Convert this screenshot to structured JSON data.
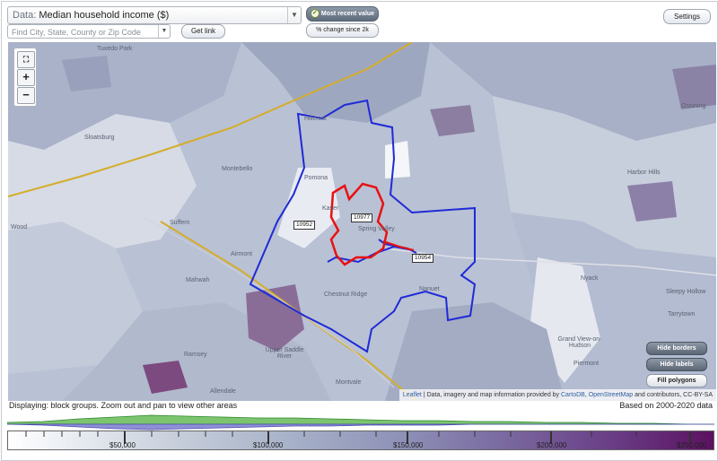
{
  "controls": {
    "data_prefix": "Data:",
    "data_value": "Median household income ($)",
    "search_placeholder": "Find City, State, County or Zip Code",
    "get_link": "Get link",
    "most_recent": "Most recent value",
    "pct_change": "% change since 2k",
    "settings": "Settings"
  },
  "map": {
    "towns": [
      "Tuxedo Park",
      "Sloatsburg",
      "Montebello",
      "Suffern",
      "Airmont",
      "Mahwah",
      "Ramsey",
      "Upper Saddle River",
      "Allendale",
      "Montvale",
      "Pomona",
      "Kaser",
      "Spring Valley",
      "Chestnut Ridge",
      "Nanuet",
      "Nyack",
      "Grand View-on-Hudson",
      "Piermont",
      "Sleepy Hollow",
      "Tarrytown",
      "Ossining",
      "Harbor Hills",
      "Hillcrest",
      "Wood"
    ],
    "zip_labels": [
      "10952",
      "10977",
      "10954"
    ],
    "buttons": {
      "hide_borders": "Hide borders",
      "hide_labels": "Hide labels",
      "fill_polygons": "Fill polygons"
    },
    "attribution": {
      "leaflet": "Leaflet",
      "text": " | Data, imagery and map information provided by ",
      "cartodb": "CartoDB",
      "comma": ", ",
      "osm": "OpenStreetMap",
      "tail": " and contributors, CC-BY-SA"
    },
    "colors": {
      "border_blue": "#1f2bd6",
      "border_red": "#e81111",
      "road": "#d4ad2a"
    }
  },
  "footer": {
    "displaying": "Displaying: block groups. Zoom out and pan to view other areas",
    "based_on": "Based on 2000-2020 data",
    "legend_ticks": [
      "$50,000",
      "$100,000",
      "$150,000",
      "$200,000",
      "$250,000"
    ]
  }
}
